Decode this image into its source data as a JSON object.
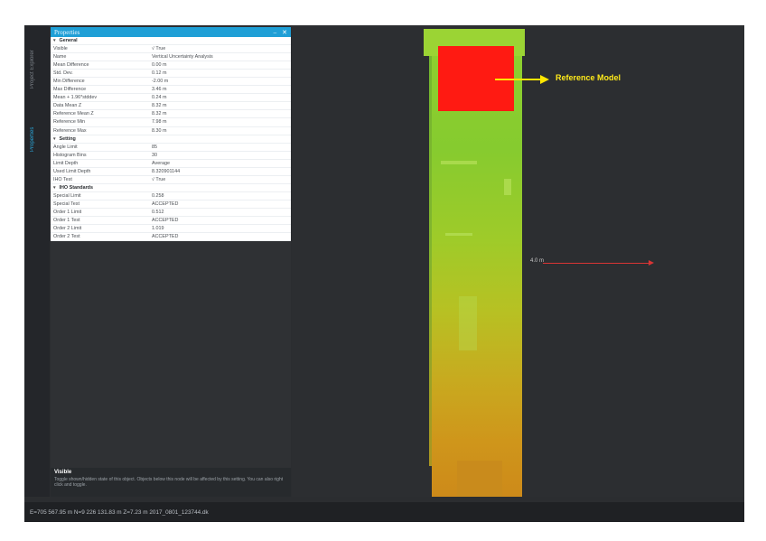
{
  "side_tabs": [
    {
      "label": "Project Explorer",
      "active": false
    },
    {
      "label": "Properties",
      "active": true
    }
  ],
  "panel": {
    "title": "Properties",
    "pin_icon": "pin-icon",
    "close_icon": "close-icon",
    "sections": [
      {
        "name": "General",
        "rows": [
          {
            "key": "Visible",
            "value": "√ True"
          },
          {
            "key": "Name",
            "value": "Vertical Uncertainty Analysis"
          },
          {
            "key": "Mean Difference",
            "value": "0.00 m"
          },
          {
            "key": "Std. Dev.",
            "value": "0.12 m"
          },
          {
            "key": "Min Difference",
            "value": "-2.00 m"
          },
          {
            "key": "Max Difference",
            "value": "3.46 m"
          },
          {
            "key": "Mean + 1.96*stddev",
            "value": "0.24 m"
          },
          {
            "key": "Data Mean Z",
            "value": "8.32 m"
          },
          {
            "key": "Reference Mean Z",
            "value": "8.32 m"
          },
          {
            "key": "Reference Min",
            "value": "7.98 m"
          },
          {
            "key": "Reference Max",
            "value": "8.30 m"
          }
        ]
      },
      {
        "name": "Setting",
        "rows": [
          {
            "key": "Angle Limit",
            "value": "85"
          },
          {
            "key": "Histogram Bins",
            "value": "30"
          },
          {
            "key": "Limit Depth",
            "value": "Average"
          },
          {
            "key": "Used Limit Depth",
            "value": "8.320901144"
          },
          {
            "key": "IHO Test",
            "value": "√ True"
          }
        ]
      },
      {
        "name": "IHO Standards",
        "rows": [
          {
            "key": "Special Limit",
            "value": "0.258"
          },
          {
            "key": "Special Test",
            "value": "ACCEPTED"
          },
          {
            "key": "Order 1 Limit",
            "value": "0.512"
          },
          {
            "key": "Order 1 Test",
            "value": "ACCEPTED"
          },
          {
            "key": "Order 2 Limit",
            "value": "1.019"
          },
          {
            "key": "Order 2 Test",
            "value": "ACCEPTED"
          }
        ]
      }
    ],
    "help_title": "Visible",
    "help_text": "Toggle shown/hidden state of this object. Objects below this node will be affected by this setting. You can also right click and toggle."
  },
  "viewport": {
    "reference_label": "Reference Model",
    "measure_label": "4.0 m",
    "colors": {
      "reference_box": "#ff1a12",
      "arrow": "#ffe600",
      "measure": "#d93535"
    }
  },
  "status_bar": {
    "text": "E=705 567.95 m N=9 226 131.83 m Z=7.23 m 2017_0801_123744.dk"
  }
}
